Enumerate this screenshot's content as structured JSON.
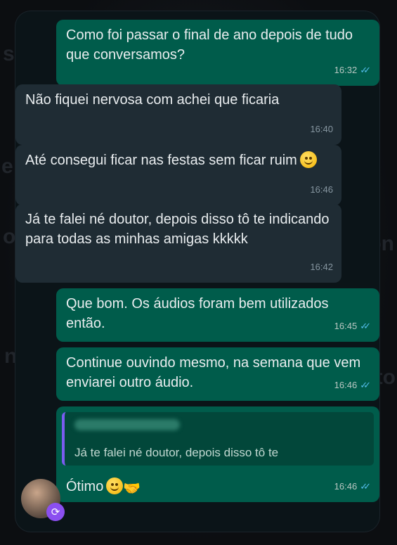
{
  "messages": [
    {
      "text": "Como foi passar o final de ano depois de tudo que conversamos?",
      "time": "16:32",
      "dir": "out"
    },
    {
      "text": "Não fiquei nervosa com achei que ficaria",
      "time": "16:40",
      "dir": "in"
    },
    {
      "text": "Até consegui ficar nas festas sem ficar ruim",
      "time": "16:46",
      "dir": "in",
      "emoji": "grinning-face"
    },
    {
      "text": "Já te falei né doutor, depois disso tô te indicando para todas as minhas amigas kkkkk",
      "time": "16:42",
      "dir": "in"
    },
    {
      "text": "Que bom. Os áudios foram bem utilizados então.",
      "time": "16:45",
      "dir": "out"
    },
    {
      "text": "Continue ouvindo mesmo, na semana que vem enviarei outro áudio.",
      "time": "16:46",
      "dir": "out"
    },
    {
      "quote": "Já te falei né doutor, depois disso tô te",
      "text": "Ótimo",
      "time": "16:46",
      "dir": "out",
      "emoji": "smiling-face",
      "emoji2": "handshake"
    }
  ],
  "ticks": "✓✓",
  "colors": {
    "outgoing": "#005c4b",
    "incoming": "#1f2c34",
    "read_ticks": "#53bdeb",
    "quote_bar": "#7a5cf0"
  },
  "avatar": {
    "badge_icon": "refresh-icon"
  }
}
